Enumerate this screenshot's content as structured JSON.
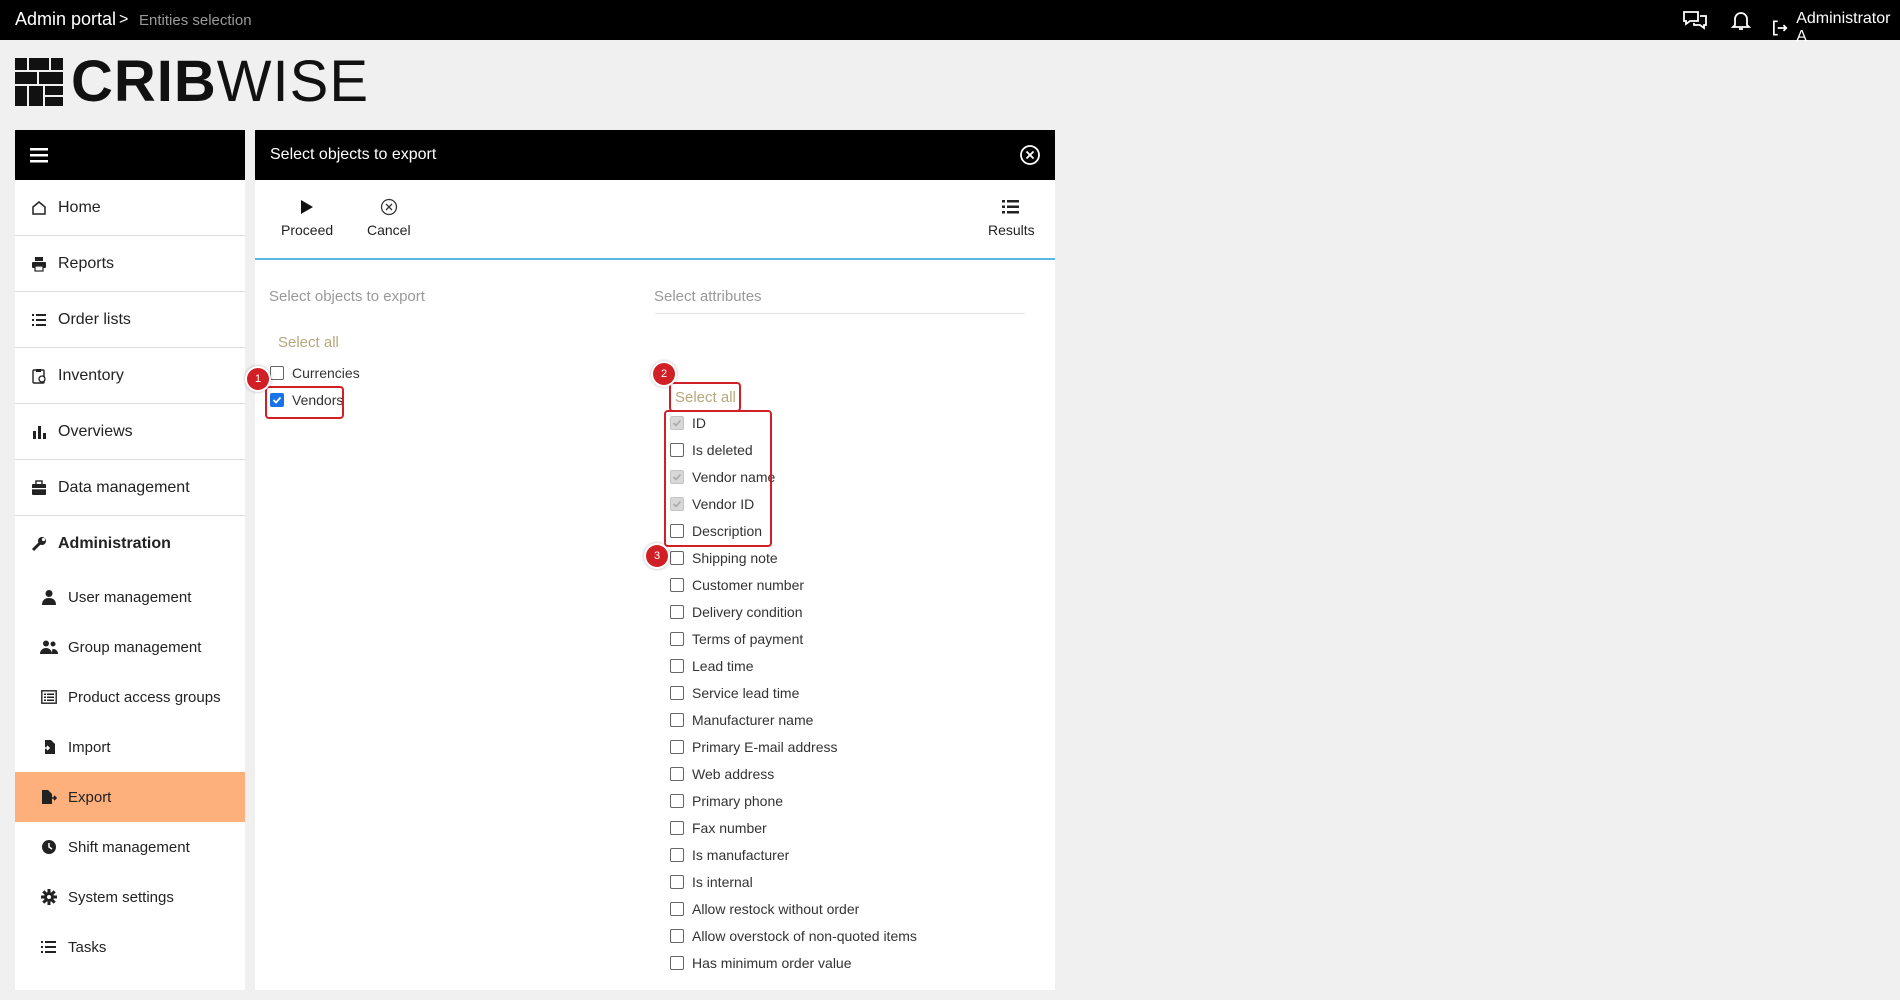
{
  "topbar": {
    "breadcrumb_root": "Admin portal",
    "breadcrumb_sep": ">",
    "breadcrumb_current": "Entities selection",
    "user_name": "Administrator A"
  },
  "logo": {
    "bold": "CRIB",
    "light": "WISE"
  },
  "sidebar": {
    "items": [
      {
        "label": "Home",
        "icon": "home-icon"
      },
      {
        "label": "Reports",
        "icon": "printer-icon"
      },
      {
        "label": "Order lists",
        "icon": "list-icon"
      },
      {
        "label": "Inventory",
        "icon": "clipboard-icon"
      },
      {
        "label": "Overviews",
        "icon": "bar-chart-icon"
      },
      {
        "label": "Data management",
        "icon": "briefcase-icon"
      },
      {
        "label": "Administration",
        "icon": "wrench-icon"
      }
    ],
    "sub_items": [
      {
        "label": "User management",
        "icon": "user-icon"
      },
      {
        "label": "Group management",
        "icon": "users-icon"
      },
      {
        "label": "Product access groups",
        "icon": "list-box-icon"
      },
      {
        "label": "Import",
        "icon": "import-icon"
      },
      {
        "label": "Export",
        "icon": "export-icon",
        "active": true
      },
      {
        "label": "Shift management",
        "icon": "clock-icon"
      },
      {
        "label": "System settings",
        "icon": "gear-icon"
      },
      {
        "label": "Tasks",
        "icon": "tasks-icon"
      }
    ]
  },
  "panel": {
    "title": "Select objects to export",
    "toolbar": {
      "proceed": "Proceed",
      "cancel": "Cancel",
      "results": "Results"
    },
    "objects_title": "Select objects to export",
    "attributes_title": "Select attributes",
    "objects_select_all": "Select all",
    "attributes_select_all": "Select all",
    "objects": [
      {
        "label": "Currencies",
        "checked": false
      },
      {
        "label": "Vendors",
        "checked": true
      }
    ],
    "attributes": [
      {
        "label": "ID",
        "state": "locked"
      },
      {
        "label": "Is deleted",
        "state": "unchecked"
      },
      {
        "label": "Vendor name",
        "state": "locked"
      },
      {
        "label": "Vendor ID",
        "state": "locked"
      },
      {
        "label": "Description",
        "state": "unchecked"
      },
      {
        "label": "Shipping note",
        "state": "unchecked"
      },
      {
        "label": "Customer number",
        "state": "unchecked"
      },
      {
        "label": "Delivery condition",
        "state": "unchecked"
      },
      {
        "label": "Terms of payment",
        "state": "unchecked"
      },
      {
        "label": "Lead time",
        "state": "unchecked"
      },
      {
        "label": "Service lead time",
        "state": "unchecked"
      },
      {
        "label": "Manufacturer name",
        "state": "unchecked"
      },
      {
        "label": "Primary E-mail address",
        "state": "unchecked"
      },
      {
        "label": "Web address",
        "state": "unchecked"
      },
      {
        "label": "Primary phone",
        "state": "unchecked"
      },
      {
        "label": "Fax number",
        "state": "unchecked"
      },
      {
        "label": "Is manufacturer",
        "state": "unchecked"
      },
      {
        "label": "Is internal",
        "state": "unchecked"
      },
      {
        "label": "Allow restock without order",
        "state": "unchecked"
      },
      {
        "label": "Allow overstock of non-quoted items",
        "state": "unchecked"
      },
      {
        "label": "Has minimum order value",
        "state": "unchecked"
      }
    ]
  },
  "annotations": {
    "badge1": "1",
    "badge2": "2",
    "badge3": "3"
  },
  "colors": {
    "accent_active": "#fdb07b",
    "annotation_red": "#d11f26",
    "toolbar_rule": "#5bb7e6",
    "select_all": "#b7a77e"
  }
}
